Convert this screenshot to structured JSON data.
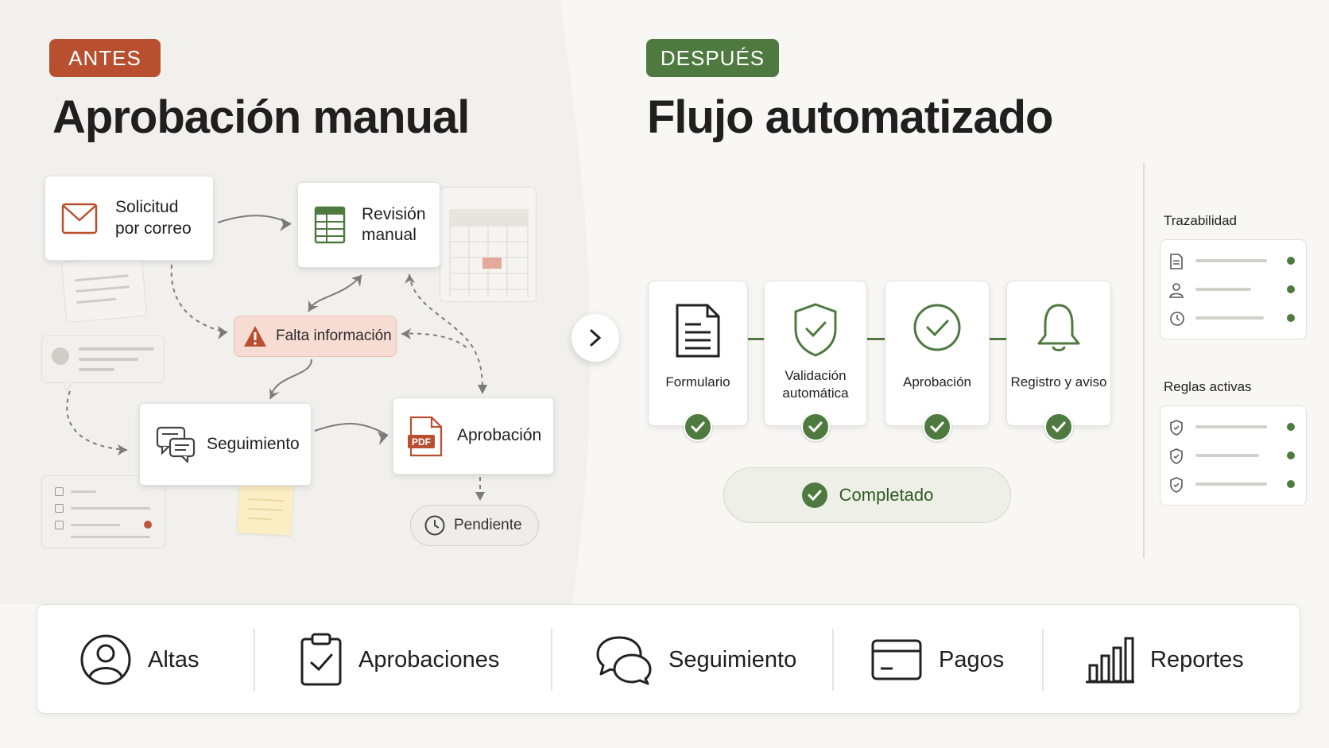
{
  "colors": {
    "before_accent": "#b8502f",
    "after_accent": "#4e7a3f",
    "warning_bg": "#f7dcd3",
    "background": "#f8f7f4"
  },
  "before": {
    "badge": "ANTES",
    "title": "Aprobación manual",
    "cards": {
      "email_request": "Solicitud\npor correo",
      "manual_review": "Revisión\nmanual",
      "follow_up": "Seguimiento",
      "approval": "Aprobación"
    },
    "warning": "Falta información",
    "pending": "Pendiente",
    "pdf_label": "PDF"
  },
  "after": {
    "badge": "DESPUÉS",
    "title": "Flujo automatizado",
    "steps": [
      {
        "label": "Formulario",
        "icon": "document-icon"
      },
      {
        "label": "Validación\nautomática",
        "icon": "shield-check-icon"
      },
      {
        "label": "Aprobación",
        "icon": "check-circle-icon"
      },
      {
        "label": "Registro y aviso",
        "icon": "bell-icon"
      }
    ],
    "completed": "Completado",
    "side": {
      "traceability_title": "Trazabilidad",
      "rules_title": "Reglas activas"
    }
  },
  "bottom": [
    {
      "label": "Altas",
      "icon": "user-icon"
    },
    {
      "label": "Aprobaciones",
      "icon": "clipboard-check-icon"
    },
    {
      "label": "Seguimiento",
      "icon": "chat-bubbles-icon"
    },
    {
      "label": "Pagos",
      "icon": "credit-card-icon"
    },
    {
      "label": "Reportes",
      "icon": "bar-chart-icon"
    }
  ]
}
